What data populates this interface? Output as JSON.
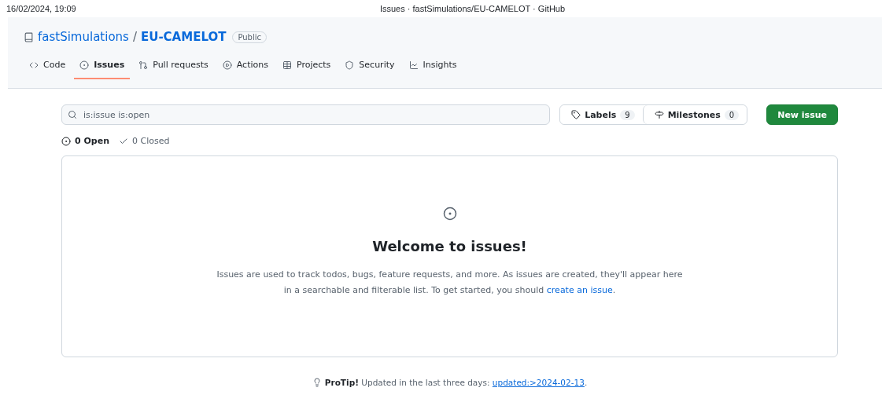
{
  "print_header": {
    "date": "16/02/2024, 19:09",
    "title": "Issues · fastSimulations/EU-CAMELOT · GitHub"
  },
  "repo": {
    "owner": "fastSimulations",
    "separator": "/",
    "name": "EU-CAMELOT",
    "visibility": "Public"
  },
  "tabs": [
    {
      "label": "Code",
      "selected": false
    },
    {
      "label": "Issues",
      "selected": true
    },
    {
      "label": "Pull requests",
      "selected": false
    },
    {
      "label": "Actions",
      "selected": false
    },
    {
      "label": "Projects",
      "selected": false
    },
    {
      "label": "Security",
      "selected": false
    },
    {
      "label": "Insights",
      "selected": false
    }
  ],
  "search": {
    "value": "is:issue is:open"
  },
  "labels_button": {
    "label": "Labels",
    "count": "9"
  },
  "milestones_button": {
    "label": "Milestones",
    "count": "0"
  },
  "new_issue_button": "New issue",
  "states": [
    {
      "label": "0 Open",
      "selected": true
    },
    {
      "label": "0 Closed",
      "selected": false
    }
  ],
  "empty_state": {
    "title": "Welcome to issues!",
    "text": "Issues are used to track todos, bugs, feature requests, and more. As issues are created, they'll appear here in a searchable and filterable list. To get started, you should ",
    "link": "create an issue",
    "after": "."
  },
  "protip": {
    "label": "ProTip!",
    "text": " Updated in the last three days: ",
    "link": "updated:>2024-02-13",
    "after": "."
  }
}
